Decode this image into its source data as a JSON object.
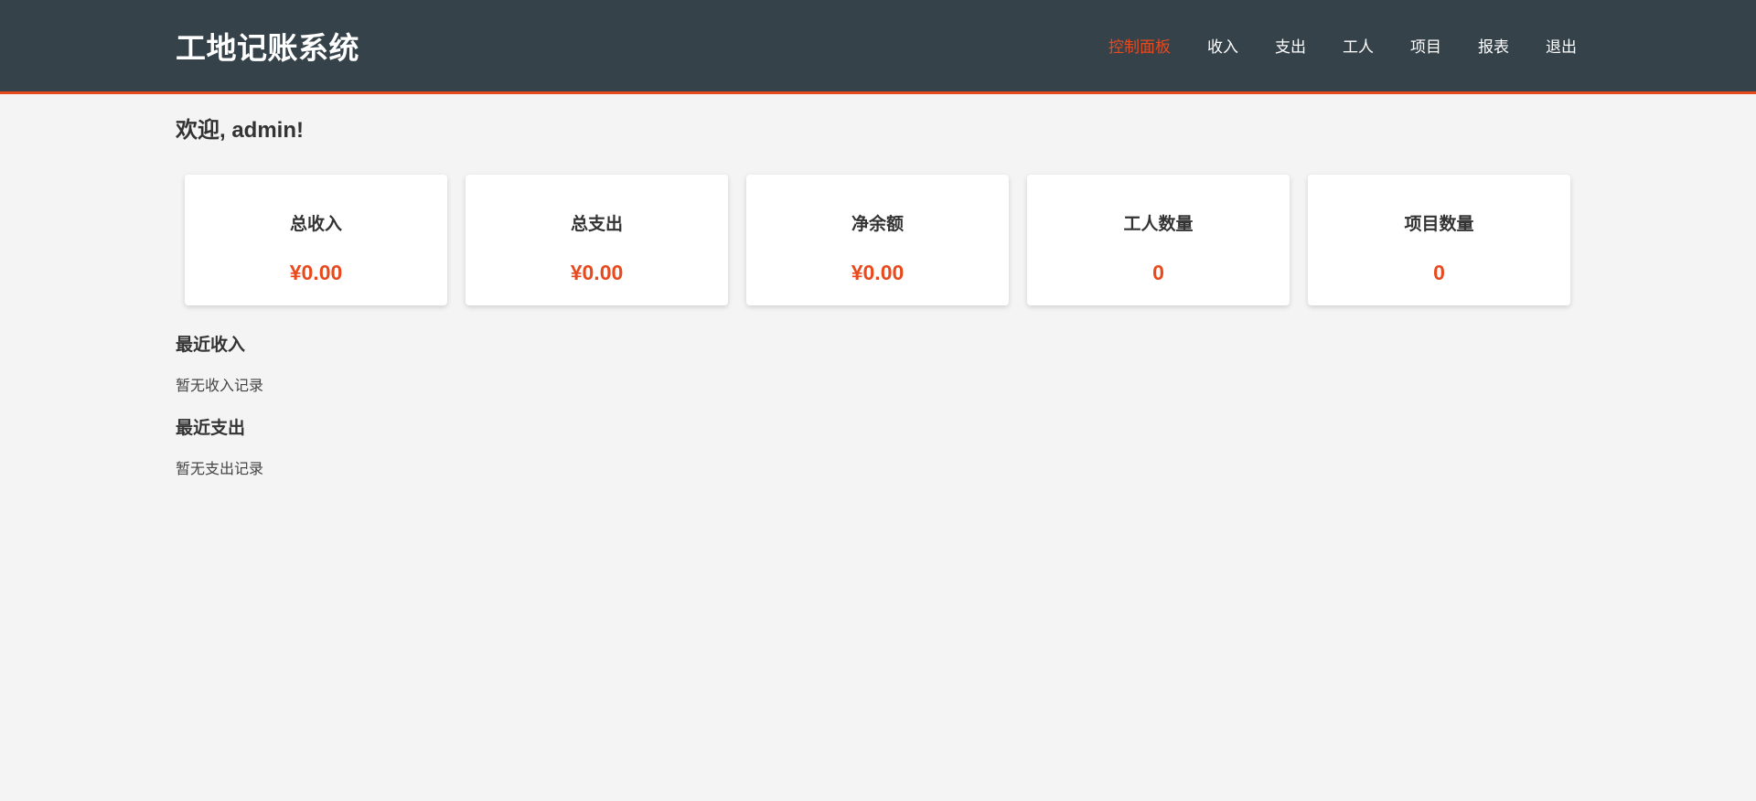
{
  "app": {
    "title": "工地记账系统"
  },
  "nav": {
    "items": [
      {
        "label": "控制面板",
        "active": true
      },
      {
        "label": "收入",
        "active": false
      },
      {
        "label": "支出",
        "active": false
      },
      {
        "label": "工人",
        "active": false
      },
      {
        "label": "项目",
        "active": false
      },
      {
        "label": "报表",
        "active": false
      },
      {
        "label": "退出",
        "active": false
      }
    ]
  },
  "dashboard": {
    "welcome": "欢迎, admin!",
    "cards": [
      {
        "title": "总收入",
        "value": "¥0.00"
      },
      {
        "title": "总支出",
        "value": "¥0.00"
      },
      {
        "title": "净余额",
        "value": "¥0.00"
      },
      {
        "title": "工人数量",
        "value": "0"
      },
      {
        "title": "项目数量",
        "value": "0"
      }
    ],
    "recent_income": {
      "title": "最近收入",
      "empty_text": "暂无收入记录"
    },
    "recent_expense": {
      "title": "最近支出",
      "empty_text": "暂无支出记录"
    }
  },
  "colors": {
    "header_bg": "#35424a",
    "accent": "#e8491d",
    "page_bg": "#f4f4f4"
  }
}
